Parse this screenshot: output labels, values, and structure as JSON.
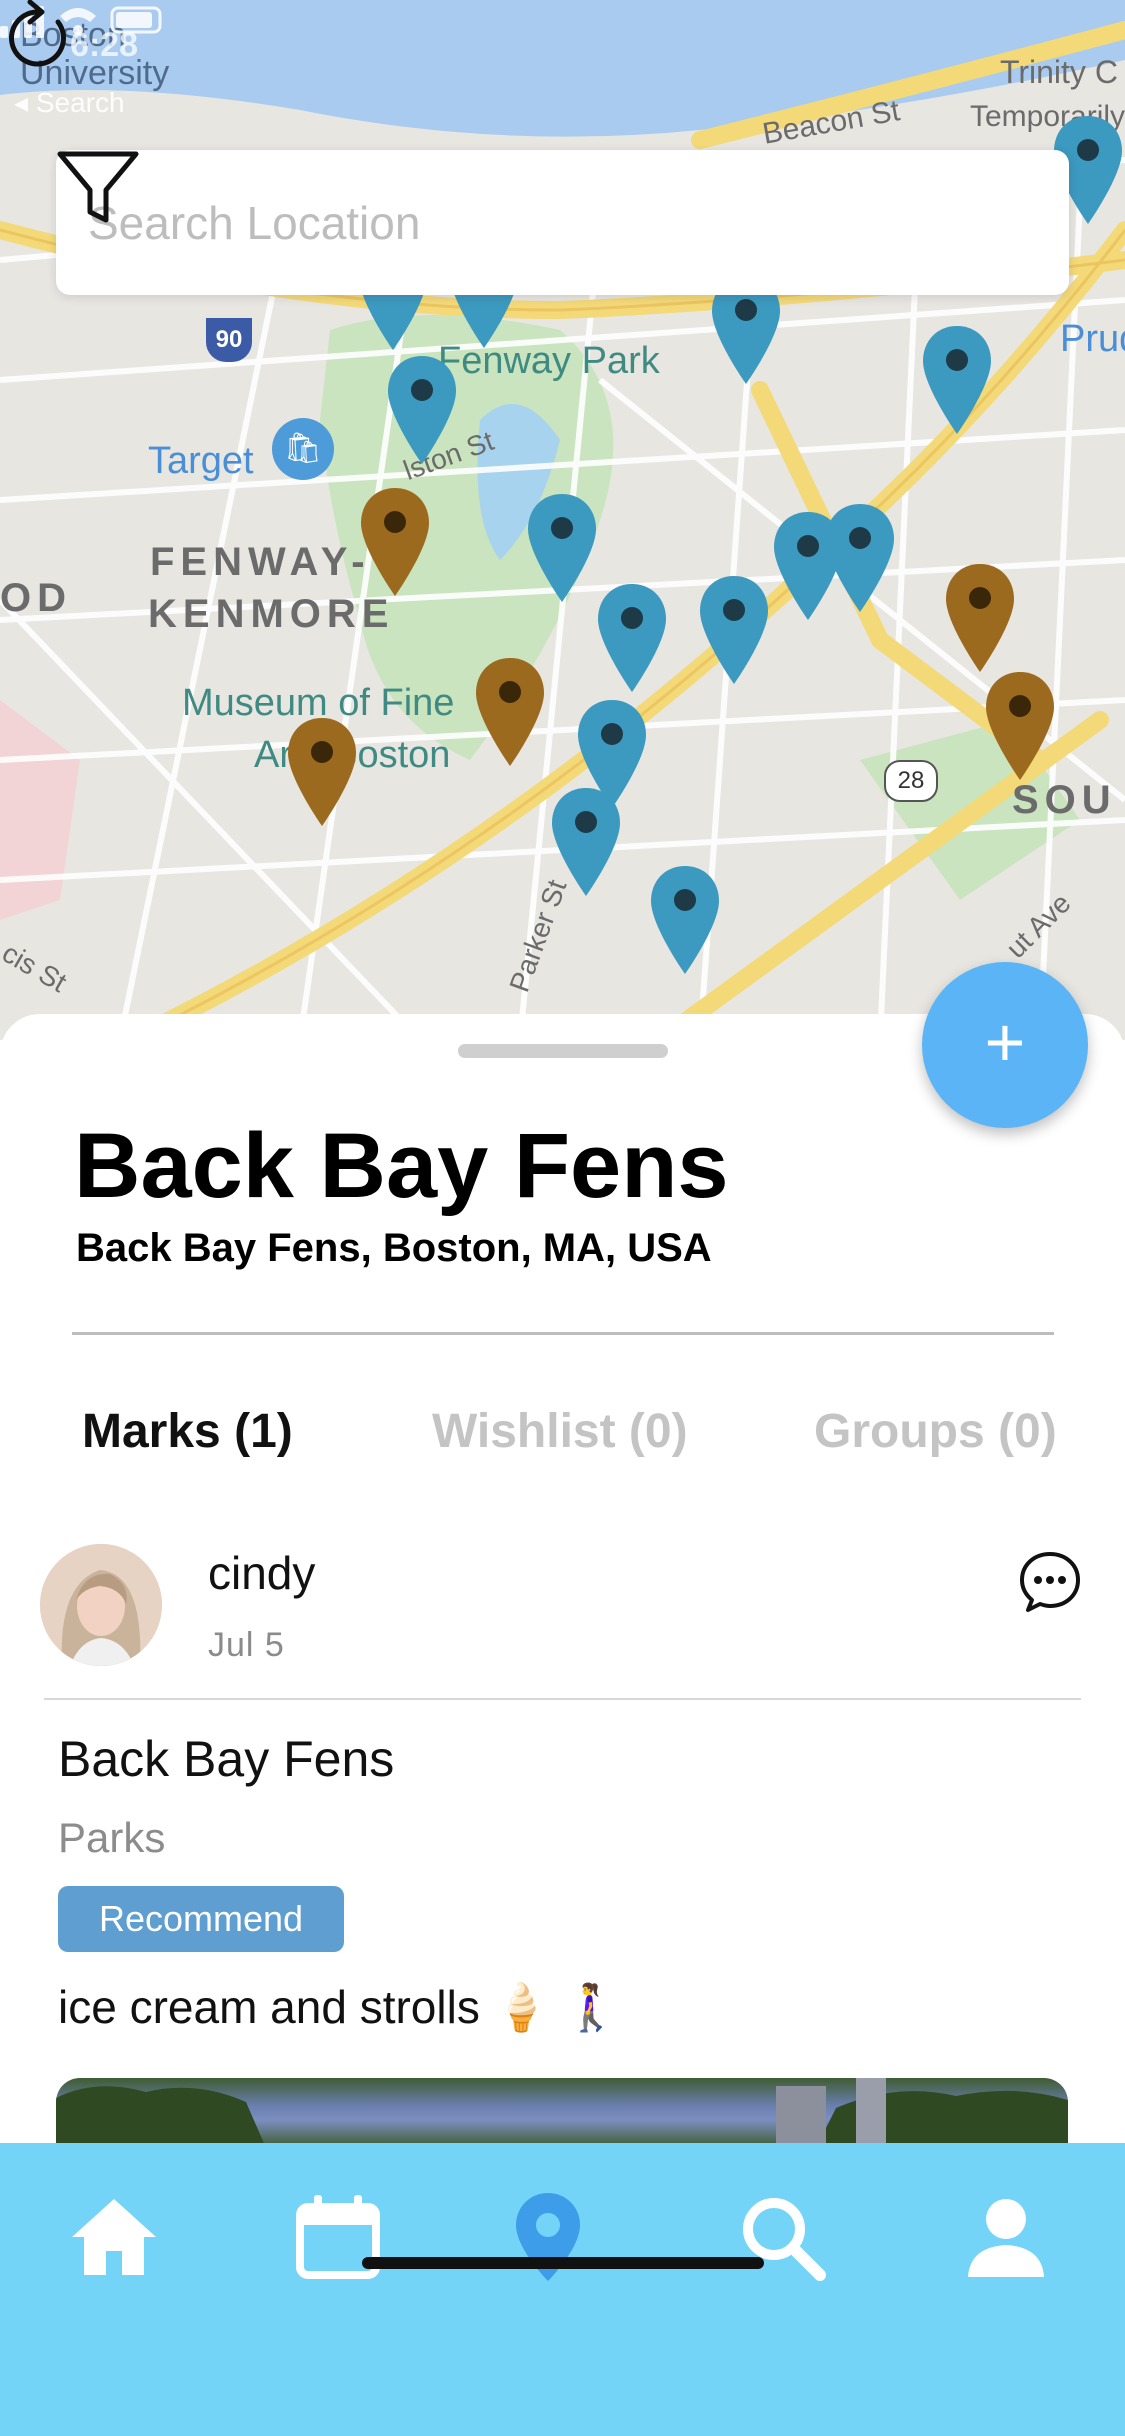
{
  "status_bar": {
    "time": "6:28",
    "back_label": "◂ Search"
  },
  "search": {
    "placeholder": "Search Location",
    "value": ""
  },
  "map": {
    "labels": {
      "boston_university": "Boston University",
      "fenway_kenmore_1": "FENWAY-",
      "fenway_kenmore_2": "KENMORE",
      "fenway_park": "Fenway Park",
      "target": "Target",
      "museum_1": "Museum of Fine",
      "museum_2": "Arts Boston",
      "prudential": "Pruden",
      "south": "SOU",
      "od": "OD",
      "beacon_st": "Beacon St",
      "trinity": "Trinity C",
      "temporarily": "Temporarily",
      "interstate": "90",
      "route": "28",
      "parker_st": "Parker St",
      "boylston_st": "lston St",
      "ave": "ut Ave",
      "cis_st": "cis St"
    },
    "pin_colors": {
      "mark": "#3c99bf",
      "wishlist": "#9c6a1f"
    }
  },
  "place": {
    "title": "Back Bay Fens",
    "address": "Back Bay Fens, Boston, MA, USA"
  },
  "tabs": [
    {
      "label": "Marks (1)",
      "active": true
    },
    {
      "label": "Wishlist (0)",
      "active": false
    },
    {
      "label": "Groups (0)",
      "active": false
    }
  ],
  "mark": {
    "username": "cindy",
    "date": "Jul 5",
    "title": "Back Bay Fens",
    "category": "Parks",
    "badge": "Recommend",
    "note": "ice cream and strolls 🍦 🚶‍♀️"
  },
  "fab": {
    "label": "+"
  },
  "tabbar": {
    "items": [
      "home-icon",
      "calendar-icon",
      "map-pin-icon",
      "search-icon",
      "profile-icon"
    ],
    "active_color": "#3e9de8",
    "inactive_color": "#ffffff"
  },
  "colors": {
    "accent": "#5ab4f5",
    "tabbar_bg": "#74d4f8",
    "badge_bg": "#5e9ed0"
  }
}
